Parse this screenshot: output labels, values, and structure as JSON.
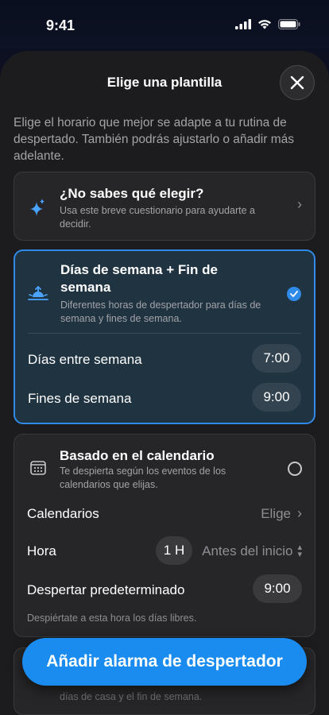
{
  "status": {
    "time": "9:41"
  },
  "sheet": {
    "title": "Elige una plantilla",
    "intro": "Elige el horario que mejor se adapte a tu rutina de despertado. También podrás ajustarlo o añadir más adelante."
  },
  "quiz": {
    "title": "¿No sabes qué elegir?",
    "subtitle": "Usa este breve cuestionario para ayudarte a decidir."
  },
  "weekday_template": {
    "title": "Días de semana + Fin de semana",
    "subtitle": "Diferentes horas de despertador para días de semana y fines de semana.",
    "rows": [
      {
        "label": "Días entre semana",
        "value": "7:00"
      },
      {
        "label": "Fines de semana",
        "value": "9:00"
      }
    ]
  },
  "calendar_template": {
    "title": "Basado en el calendario",
    "subtitle": "Te despierta según los eventos de los calendarios que elijas.",
    "calendars_label": "Calendarios",
    "calendars_value": "Elige",
    "hour_label": "Hora",
    "hour_value": "1 H",
    "hour_option": "Antes del inicio",
    "default_label": "Despertar predeterminado",
    "default_value": "9:00",
    "footnote": "Despiértate a esta hora los días libres."
  },
  "peek": {
    "text": "días de casa y el fin de semana."
  },
  "cta": {
    "label": "Añadir alarma de despertador"
  },
  "colors": {
    "accent": "#1a8cf0",
    "selected_border": "#2f8ae8"
  }
}
